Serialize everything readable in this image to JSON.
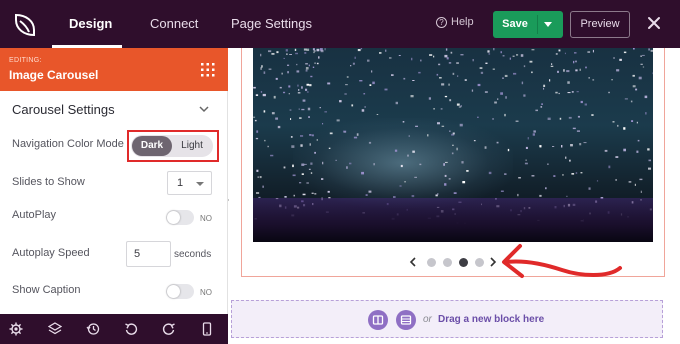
{
  "topbar": {
    "tabs": [
      {
        "label": "Design"
      },
      {
        "label": "Connect"
      },
      {
        "label": "Page Settings"
      }
    ],
    "help_label": "Help",
    "save_label": "Save",
    "preview_label": "Preview"
  },
  "panel": {
    "editing_label": "EDITING:",
    "block_title": "Image Carousel",
    "section_title": "Carousel Settings",
    "navigation_color_mode": {
      "label": "Navigation Color Mode",
      "options": [
        "Dark",
        "Light"
      ],
      "selected": "Dark"
    },
    "slides_to_show": {
      "label": "Slides to Show",
      "value": "1"
    },
    "autoplay": {
      "label": "AutoPlay",
      "state": "NO"
    },
    "autoplay_speed": {
      "label": "Autoplay Speed",
      "value": "5",
      "unit": "seconds"
    },
    "show_caption": {
      "label": "Show Caption",
      "state": "NO"
    }
  },
  "canvas": {
    "carousel": {
      "dot_count": 4,
      "active_dot": 3
    },
    "dropzone": {
      "or_label": "or",
      "text": "Drag a new block here"
    }
  },
  "colors": {
    "topbar_bg": "#2f0e2c",
    "header_orange": "#e8562a",
    "save_green": "#1a9b5a",
    "highlight_red": "#e02a2a",
    "dropzone_purple": "#8f6fc4"
  }
}
